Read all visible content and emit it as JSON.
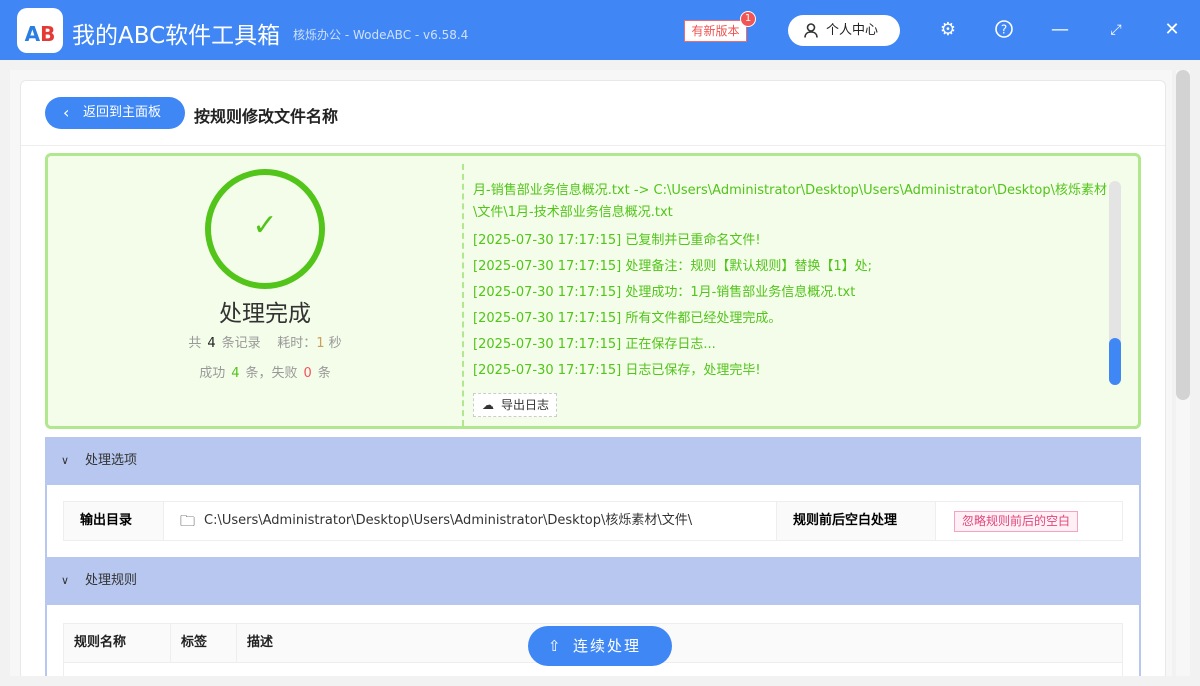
{
  "app": {
    "logo": "AB",
    "title": "我的ABC软件工具箱",
    "subtitle": "核烁办公 - WodeABC - v6.58.4",
    "new_version": "有新版本",
    "badge": "1",
    "user_center": "个人中心"
  },
  "header": {
    "back": "返回到主面板",
    "title": "按规则修改文件名称"
  },
  "result": {
    "status": "处理完成",
    "total_prefix": "共",
    "total": "4",
    "total_suffix": "条记录",
    "time_label": "耗时：",
    "time": "1",
    "time_unit": "秒",
    "success_label": "成功",
    "success": "4",
    "success_unit": "条，失败",
    "fail": "0",
    "fail_unit": "条"
  },
  "log": [
    "月-销售部业务信息概况.txt -> C:\\Users\\Administrator\\Desktop\\Users\\Administrator\\Desktop\\核烁素材\\文件\\1月-技术部业务信息概况.txt",
    "[2025-07-30 17:17:15] 已复制并已重命名文件!",
    "[2025-07-30 17:17:15] 处理备注：规则【默认规则】替换【1】处;",
    "[2025-07-30 17:17:15] 处理成功：1月-销售部业务信息概况.txt",
    "[2025-07-30 17:17:15] 所有文件都已经处理完成。",
    "[2025-07-30 17:17:15] 正在保存日志...",
    "[2025-07-30 17:17:15] 日志已保存，处理完毕!"
  ],
  "export_log": "导出日志",
  "options": {
    "title": "处理选项",
    "output_label": "输出目录",
    "output_path": "C:\\Users\\Administrator\\Desktop\\Users\\Administrator\\Desktop\\核烁素材\\文件\\",
    "blank_label": "规则前后空白处理",
    "blank_value": "忽略规则前后的空白"
  },
  "rules": {
    "title": "处理规则",
    "columns": [
      "规则名称",
      "标签",
      "描述"
    ]
  },
  "continue": "连续处理"
}
